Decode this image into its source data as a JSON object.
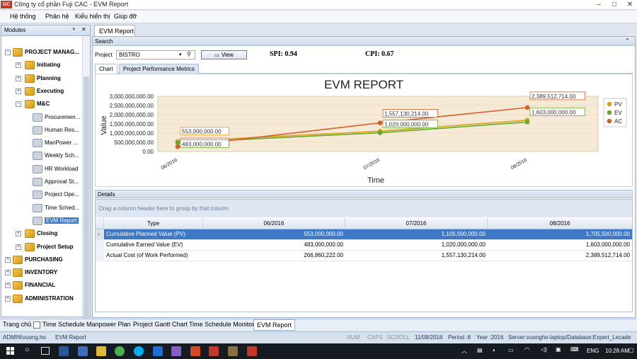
{
  "window": {
    "title": "Công ty cổ phần Fuji CAC - EVM Report",
    "logo": "GC"
  },
  "menu": [
    "Hệ thống",
    "Phân hệ",
    "Kiểu hiển thị",
    "Giúp đỡ"
  ],
  "modules": {
    "title": "Modules",
    "pin": "ᵖ",
    "close": "✕",
    "items": [
      {
        "label": "PROJECT MANAG...",
        "level": 0,
        "bold": true,
        "exp": "−",
        "icon": "folder"
      },
      {
        "label": "Initiating",
        "level": 1,
        "bold": true,
        "exp": "+",
        "icon": "folder"
      },
      {
        "label": "Planning",
        "level": 1,
        "bold": true,
        "exp": "+",
        "icon": "folder"
      },
      {
        "label": "Executing",
        "level": 1,
        "bold": true,
        "exp": "+",
        "icon": "folder"
      },
      {
        "label": "M&C",
        "level": 1,
        "bold": true,
        "exp": "−",
        "icon": "folder"
      },
      {
        "label": "Procuremen...",
        "level": 2,
        "bold": false,
        "exp": "",
        "icon": "leaf"
      },
      {
        "label": "Human Res...",
        "level": 2,
        "bold": false,
        "exp": "",
        "icon": "leaf"
      },
      {
        "label": "ManPower ...",
        "level": 2,
        "bold": false,
        "exp": "",
        "icon": "leaf"
      },
      {
        "label": "Weekly Sch...",
        "level": 2,
        "bold": false,
        "exp": "",
        "icon": "leaf"
      },
      {
        "label": "HR Workload",
        "level": 2,
        "bold": false,
        "exp": "",
        "icon": "leaf"
      },
      {
        "label": "Approval St...",
        "level": 2,
        "bold": false,
        "exp": "",
        "icon": "leaf"
      },
      {
        "label": "Project Ope...",
        "level": 2,
        "bold": false,
        "exp": "",
        "icon": "leaf"
      },
      {
        "label": "Time Sched...",
        "level": 2,
        "bold": false,
        "exp": "",
        "icon": "leaf"
      },
      {
        "label": "EVM Report",
        "level": 2,
        "bold": false,
        "exp": "",
        "icon": "leaf",
        "selected": true
      },
      {
        "label": "Closing",
        "level": 1,
        "bold": true,
        "exp": "+",
        "icon": "folder"
      },
      {
        "label": "Project Setup",
        "level": 1,
        "bold": true,
        "exp": "+",
        "icon": "folder"
      },
      {
        "label": "PURCHASING",
        "level": 0,
        "bold": true,
        "exp": "+",
        "icon": "folder"
      },
      {
        "label": "INVENTORY",
        "level": 0,
        "bold": true,
        "exp": "+",
        "icon": "folder"
      },
      {
        "label": "FINANCIAL",
        "level": 0,
        "bold": true,
        "exp": "+",
        "icon": "folder"
      },
      {
        "label": "ADMINISTRATION",
        "level": 0,
        "bold": true,
        "exp": "+",
        "icon": "folder"
      }
    ]
  },
  "doc_tab": "EVM Report",
  "search": {
    "title": "Search",
    "collapse": "⌃",
    "project_label": "Project",
    "project_value": "BISTRO",
    "view_label": "View"
  },
  "metrics": {
    "spi": "SPI: 0.94",
    "cpi": "CPI: 0.67"
  },
  "tabs": [
    "Chart",
    "Project Performance Metrics"
  ],
  "chart_data": {
    "type": "line",
    "title": "EVM REPORT",
    "xlabel": "Time",
    "ylabel": "Value",
    "categories": [
      "06/2016",
      "07/2016",
      "08/2016"
    ],
    "yticks": [
      "0.00",
      "500,000,000.00",
      "1,000,000,000.00",
      "1,500,000,000.00",
      "2,000,000,000.00",
      "2,500,000,000.00",
      "3,000,000,000.00"
    ],
    "ylim": [
      0,
      3000000000
    ],
    "legend_position": "right",
    "series": [
      {
        "name": "PV",
        "color": "#d9a21b",
        "values": [
          553000000,
          1105000000,
          1705500000
        ],
        "labels": [
          "553,000,000.00",
          "",
          "1,705,500,000.00"
        ]
      },
      {
        "name": "EV",
        "color": "#67a82e",
        "values": [
          483000000,
          1020000000,
          1603000000
        ],
        "labels": [
          "483,000,000.00",
          "1,020,000,000.00",
          "1,603,000,000.00"
        ]
      },
      {
        "name": "AC",
        "color": "#d35f2a",
        "values": [
          266860222,
          1557130214,
          2389512714
        ],
        "labels": [
          "266,860,222.00",
          "1,557,130,214.00",
          "2,389,512,714.00"
        ]
      }
    ]
  },
  "details": {
    "title": "Details",
    "group_hint": "Drag a column header here to group by that column",
    "columns": [
      "Type",
      "06/2016",
      "07/2016",
      "08/2016"
    ],
    "rows": [
      {
        "type": "Cumulative Planned Value (PV)",
        "v": [
          "553,000,000.00",
          "1,105,000,000.00",
          "1,705,500,000.00"
        ]
      },
      {
        "type": "Cumulative Earned Value (EV)",
        "v": [
          "483,000,000.00",
          "1,020,000,000.00",
          "1,603,000,000.00"
        ]
      },
      {
        "type": "Actual Cost (of Work Performed)",
        "v": [
          "266,860,222.00",
          "1,557,130,214.00",
          "2,389,512,714.00"
        ]
      }
    ]
  },
  "bottom_tabs": [
    "Trang chủ",
    "Time Schedule",
    "Manpower Plan",
    "Project Gantt Chart",
    "Time Schedule Monitor",
    "EVM Report"
  ],
  "status": {
    "user": "ADMIN\\vuong.ho",
    "screen": "EVM Report",
    "num": "NUM",
    "caps": "CAPS",
    "scroll": "SCROLL",
    "date": "11/08/2016",
    "period": "Period :8",
    "year": "Year :2016",
    "server": "Server:vuongho-laptop/Database:Expert_Lecade"
  },
  "taskbar": {
    "lang": "ENG",
    "time": "10:28 AM"
  }
}
